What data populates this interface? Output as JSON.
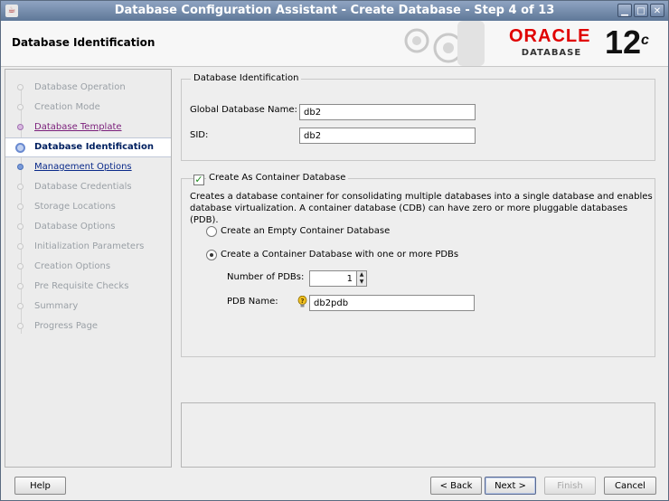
{
  "window": {
    "title": "Database Configuration Assistant - Create Database - Step 4 of 13",
    "app_icon": "java-icon",
    "controls": [
      "minimize-icon",
      "maximize-icon",
      "close-icon"
    ]
  },
  "header": {
    "page_title": "Database Identification",
    "brand": {
      "name": "ORACLE",
      "registered": "®",
      "product": "DATABASE",
      "version": "12",
      "version_suffix": "c",
      "color": "#e00000"
    }
  },
  "sidebar": {
    "steps": [
      {
        "label": "Database Operation",
        "state": "disabled"
      },
      {
        "label": "Creation Mode",
        "state": "disabled"
      },
      {
        "label": "Database Template",
        "state": "visited"
      },
      {
        "label": "Database Identification",
        "state": "current"
      },
      {
        "label": "Management Options",
        "state": "link"
      },
      {
        "label": "Database Credentials",
        "state": "disabled"
      },
      {
        "label": "Storage Locations",
        "state": "disabled"
      },
      {
        "label": "Database Options",
        "state": "disabled"
      },
      {
        "label": "Initialization Parameters",
        "state": "disabled"
      },
      {
        "label": "Creation Options",
        "state": "disabled"
      },
      {
        "label": "Pre Requisite Checks",
        "state": "disabled"
      },
      {
        "label": "Summary",
        "state": "disabled"
      },
      {
        "label": "Progress Page",
        "state": "disabled"
      }
    ]
  },
  "identification": {
    "legend": "Database Identification",
    "global_name_label": "Global Database Name:",
    "global_name_value": "db2",
    "sid_label": "SID:",
    "sid_value": "db2"
  },
  "container": {
    "checkbox_label": "Create As Container Database",
    "checked": true,
    "description_line1": "Creates a database container for consolidating multiple databases into a single database and enables",
    "description_line2": "database virtualization. A container database (CDB) can have zero or more pluggable databases (PDB).",
    "option_empty_label": "Create an Empty Container Database",
    "option_pdbs_label": "Create a Container Database with one or more PDBs",
    "selected_option": "pdbs",
    "num_pdbs_label": "Number of PDBs:",
    "num_pdbs_value": "1",
    "pdb_name_label": "PDB Name:",
    "pdb_name_value": "db2pdb"
  },
  "buttons": {
    "help": "Help",
    "back": "< Back",
    "next": "Next >",
    "finish": "Finish",
    "cancel": "Cancel"
  }
}
